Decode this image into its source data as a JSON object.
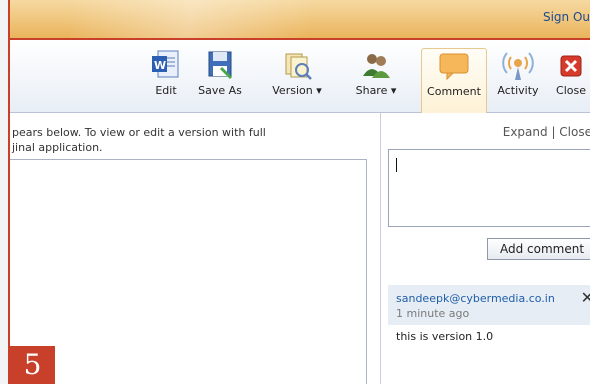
{
  "header": {
    "signout_label": "Sign Ou"
  },
  "toolbar": {
    "items": [
      {
        "label": "Edit"
      },
      {
        "label": "Save As"
      },
      {
        "label": "Version ▾"
      },
      {
        "label": "Share ▾"
      },
      {
        "label": "Comment"
      },
      {
        "label": "Activity"
      },
      {
        "label": "Close"
      }
    ]
  },
  "document": {
    "message_line1": "pears below. To view or edit a version with full",
    "message_line2": "jinal application."
  },
  "comments": {
    "expand_close": "Expand  |  Close",
    "input_value": "",
    "add_button": "Add comment",
    "list": [
      {
        "author": "sandeepk@cybermedia.co.in",
        "time": "1 minute ago",
        "text": "this is version 1.0"
      }
    ]
  },
  "page_badge": "5",
  "colors": {
    "accent": "#c8402a",
    "link": "#1f5ea8"
  }
}
